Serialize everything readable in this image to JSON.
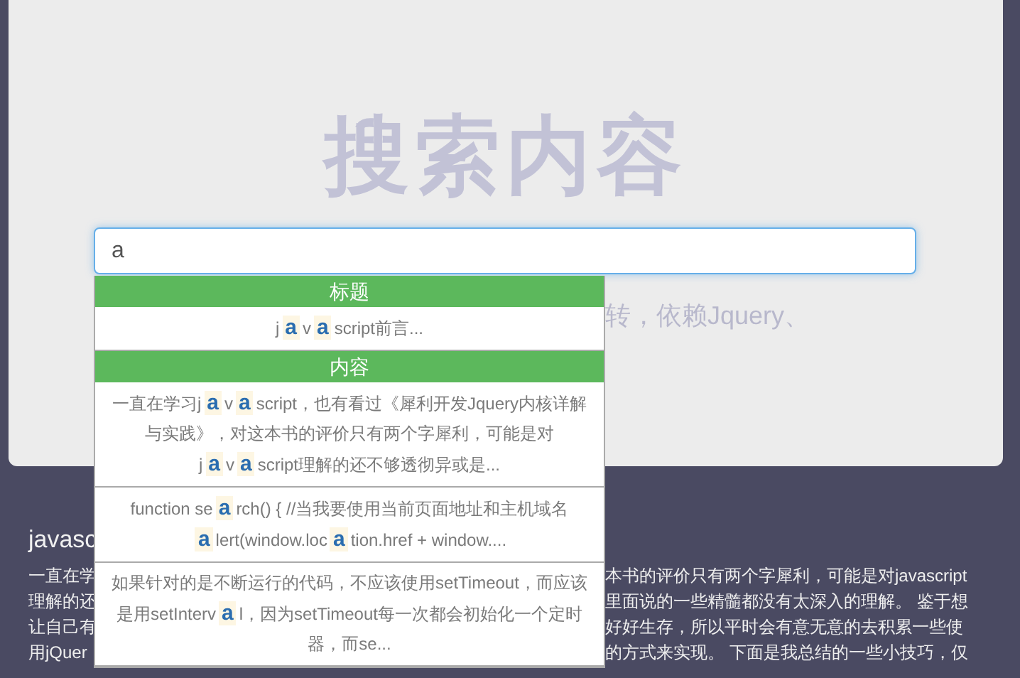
{
  "hero": {
    "title": "搜索内容",
    "subtitle_visible": "转，依赖Jquery、"
  },
  "search": {
    "value": "a"
  },
  "suggestions": [
    {
      "kind": "header",
      "label": "标题"
    },
    {
      "kind": "result",
      "segments": [
        {
          "text": "j",
          "highlight": false
        },
        {
          "text": "a",
          "highlight": true
        },
        {
          "text": "v",
          "highlight": false
        },
        {
          "text": "a",
          "highlight": true
        },
        {
          "text": "script前言...",
          "highlight": false
        }
      ]
    },
    {
      "kind": "header",
      "label": "内容"
    },
    {
      "kind": "result",
      "segments": [
        {
          "text": "一直在学习j",
          "highlight": false
        },
        {
          "text": "a",
          "highlight": true
        },
        {
          "text": "v",
          "highlight": false
        },
        {
          "text": "a",
          "highlight": true
        },
        {
          "text": "script，也有看过《犀利开发Jquery内核详解与实践》，对这本书的评价只有两个字犀利，可能是对j",
          "highlight": false
        },
        {
          "text": "a",
          "highlight": true
        },
        {
          "text": "v",
          "highlight": false
        },
        {
          "text": "a",
          "highlight": true
        },
        {
          "text": "script理解的还不够透彻异或是...",
          "highlight": false
        }
      ]
    },
    {
      "kind": "result",
      "segments": [
        {
          "text": "function se",
          "highlight": false
        },
        {
          "text": "a",
          "highlight": true
        },
        {
          "text": "rch() { //当我要使用当前页面地址和主机域名 ",
          "highlight": false
        },
        {
          "text": "a",
          "highlight": true
        },
        {
          "text": "lert(window.loc",
          "highlight": false
        },
        {
          "text": "a",
          "highlight": true
        },
        {
          "text": "tion.href + window....",
          "highlight": false
        }
      ]
    },
    {
      "kind": "result",
      "segments": [
        {
          "text": "如果针对的是不断运行的代码，不应该使用setTimeout，而应该是用setInterv",
          "highlight": false
        },
        {
          "text": "a",
          "highlight": true
        },
        {
          "text": "l，因为setTimeout每一次都会初始化一个定时器，而se...",
          "highlight": false
        }
      ]
    }
  ],
  "article": {
    "title_visible": "javasc",
    "lines": [
      {
        "left": "一直在学",
        "right": "本书的评价只有两个字犀利，可能是对javascript"
      },
      {
        "left": "理解的还",
        "right": "里面说的一些精髓都没有太深入的理解。 鉴于想"
      },
      {
        "left": "让自己有",
        "right": "好好生存，所以平时会有意无意的去积累一些使"
      },
      {
        "left": "用jQuer",
        "right": "的方式来实现。 下面是我总结的一些小技巧，仅"
      }
    ]
  }
}
